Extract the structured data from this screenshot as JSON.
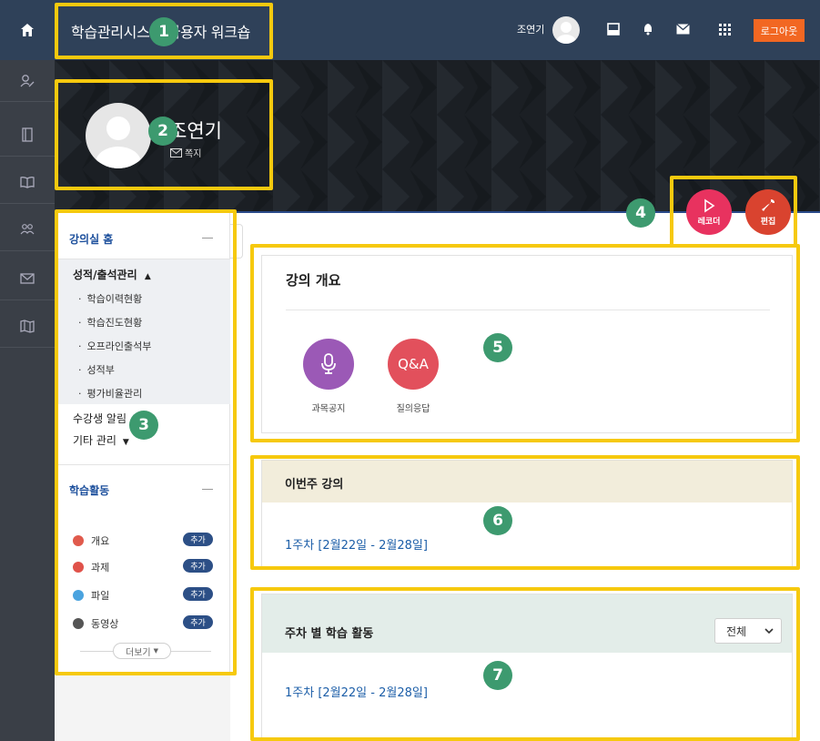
{
  "header": {
    "site_title": "학습관리시스템 사용자 워크숍",
    "user_name": "조연기",
    "logout_label": "로그아웃"
  },
  "profile": {
    "name": "조연기",
    "message_label": "쪽지"
  },
  "actions": {
    "recorder_label": "레코더",
    "edit_label": "편집"
  },
  "sidebar": {
    "course_home": "강의실 홈",
    "grade_section": "성적/출석관리",
    "grade_items": [
      "학습이력현황",
      "학습진도현황",
      "오프라인출석부",
      "성적부",
      "평가비율관리"
    ],
    "notify_label": "수강생 알림",
    "etc_label": "기타 관리",
    "activity_title": "학습활동",
    "activities": [
      {
        "label": "개요",
        "color": "#e05a4c"
      },
      {
        "label": "과제",
        "color": "#e0524a"
      },
      {
        "label": "파일",
        "color": "#4aa3df"
      },
      {
        "label": "동영상",
        "color": "#555555"
      }
    ],
    "add_label": "추가",
    "more_label": "더보기"
  },
  "overview": {
    "title": "강의 개요",
    "modules": [
      {
        "label": "과목공지",
        "color": "#9b59b6"
      },
      {
        "label": "질의응답",
        "color": "#e2505c",
        "text": "Q&A"
      }
    ]
  },
  "this_week": {
    "title": "이번주 강의",
    "week_link": "1주차 [2월22일 - 2월28일]"
  },
  "weekly": {
    "title": "주차 별 학습 활동",
    "filter_value": "전체",
    "week_link": "1주차 [2월22일 - 2월28일]"
  },
  "annotations": [
    "1",
    "2",
    "3",
    "4",
    "5",
    "6",
    "7"
  ],
  "colors": {
    "header_bg": "#2f4159",
    "annotation": "#f6c90e",
    "badge": "#3d9a6f",
    "logout": "#f26722"
  }
}
